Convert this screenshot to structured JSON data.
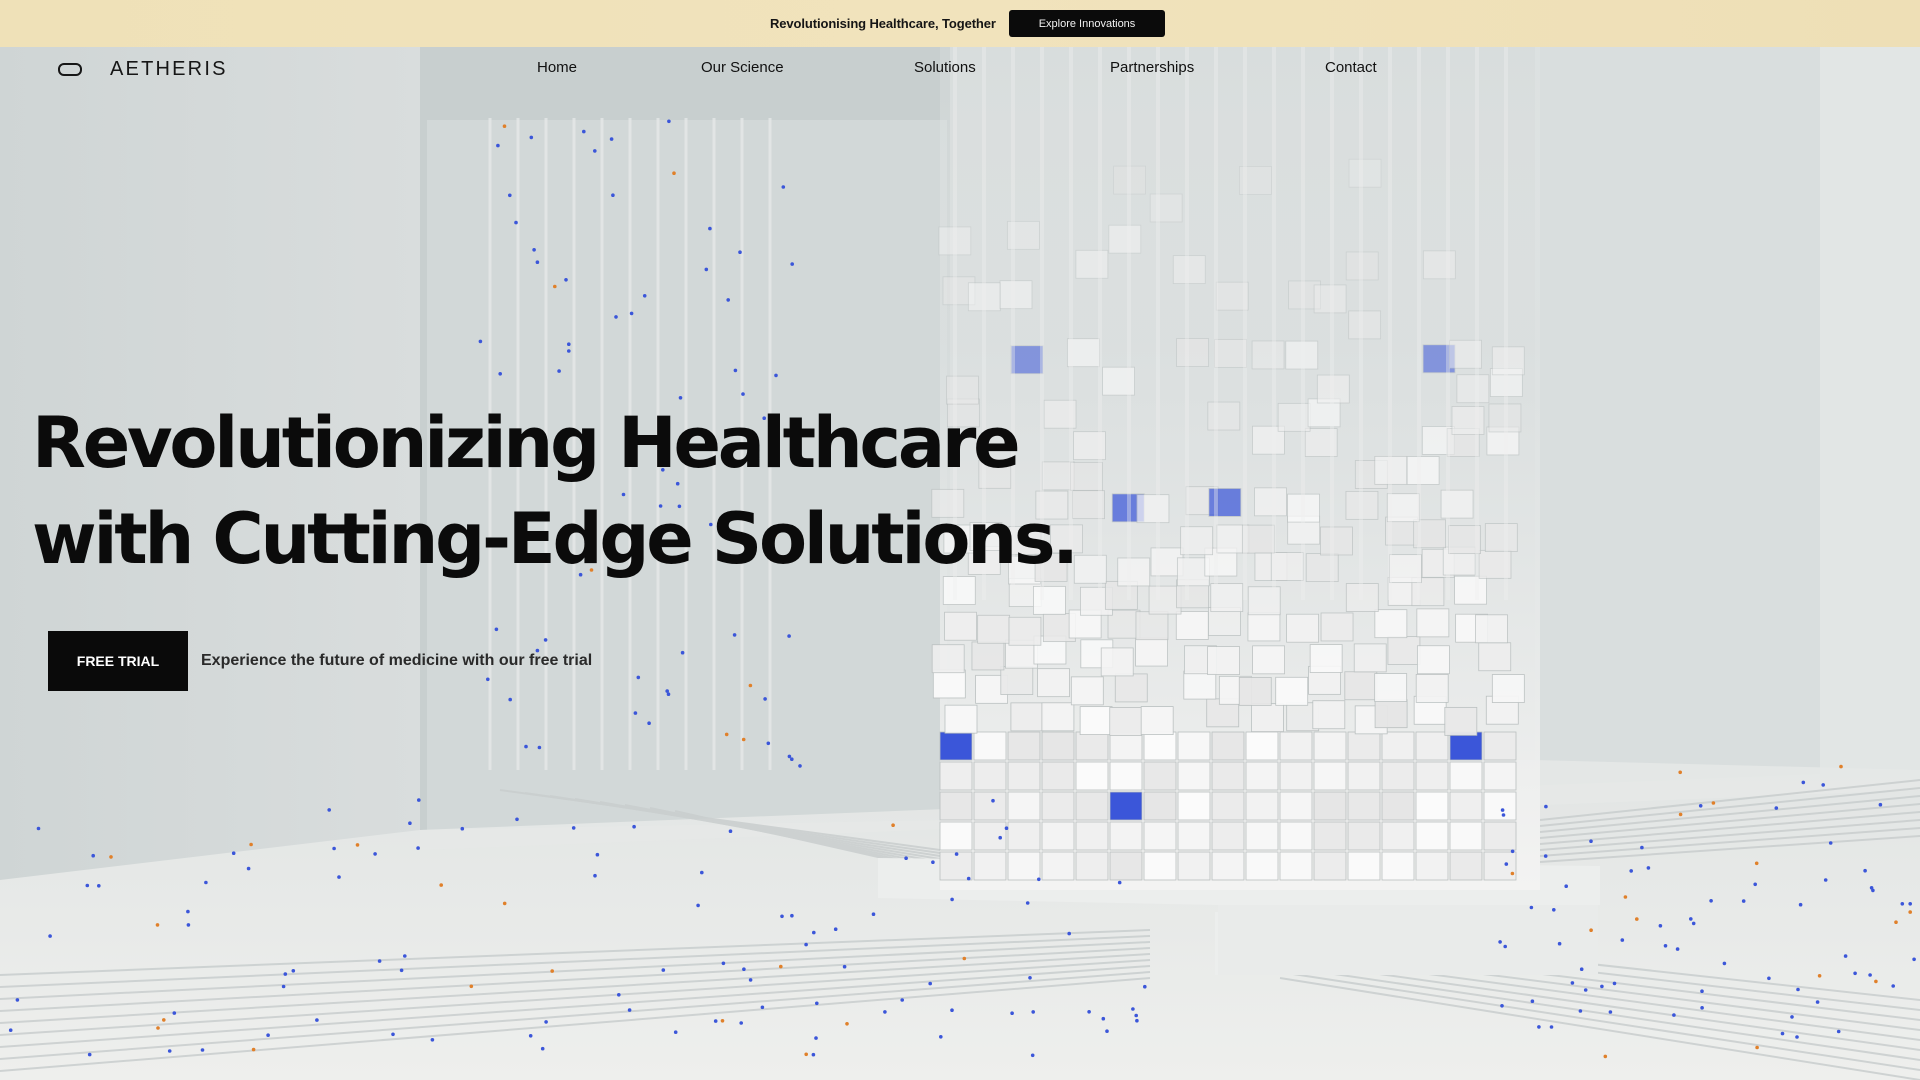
{
  "announcement": {
    "text": "Revolutionising Healthcare, Together",
    "button_label": "Explore Innovations"
  },
  "brand": {
    "name": "AETHERIS",
    "icon": "rounded-rectangle-logo-icon"
  },
  "nav": {
    "items": [
      {
        "label": "Home"
      },
      {
        "label": "Our Science"
      },
      {
        "label": "Solutions"
      },
      {
        "label": "Partnerships"
      },
      {
        "label": "Contact"
      }
    ]
  },
  "hero": {
    "title_line1": "Revolutionizing Healthcare",
    "title_line2": "with Cutting-Edge Solutions.",
    "cta_label": "FREE TRIAL",
    "cta_caption": "Experience the future of medicine with our free trial"
  },
  "colors": {
    "announcement_bg": "#efe1b8",
    "button_dark": "#0b0b0b",
    "scene_base": "#d6dbdb",
    "accent_blue": "#3b56d9",
    "accent_orange": "#e0802a"
  }
}
